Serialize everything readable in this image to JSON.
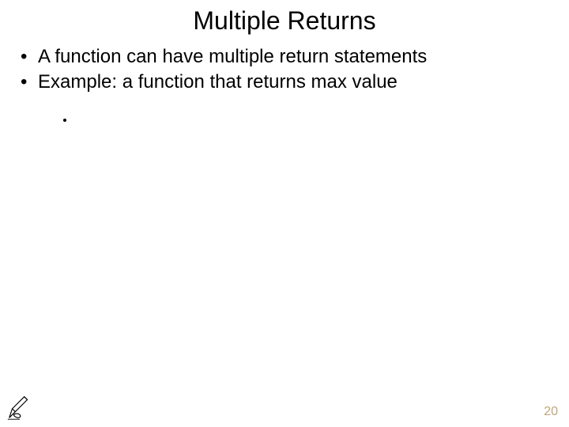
{
  "title": "Multiple Returns",
  "bullets": [
    "A function can have multiple return statements",
    "Example: a function that returns max value"
  ],
  "page_number": "20"
}
